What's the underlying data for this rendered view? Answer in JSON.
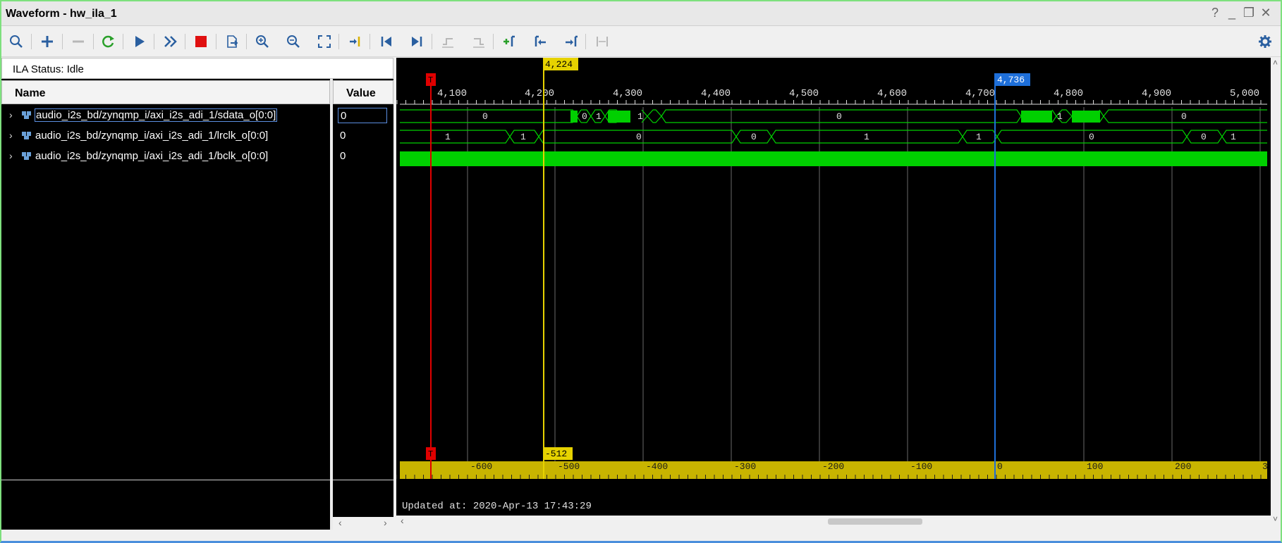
{
  "window": {
    "title": "Waveform - hw_ila_1",
    "controls": [
      "?",
      "_",
      "❐",
      "✕"
    ]
  },
  "toolbar": {
    "buttons": [
      {
        "name": "search",
        "icon": "search-icon"
      },
      {
        "name": "add",
        "icon": "plus-icon"
      },
      {
        "name": "remove",
        "icon": "minus-icon",
        "disabled": true
      },
      {
        "name": "run-trigger-immediate",
        "icon": "refresh-icon"
      },
      {
        "name": "run-trigger",
        "icon": "play-icon"
      },
      {
        "name": "run-continuous",
        "icon": "fast-forward-icon"
      },
      {
        "name": "stop",
        "icon": "stop-icon"
      },
      {
        "name": "export",
        "icon": "export-icon"
      },
      {
        "name": "zoom-in",
        "icon": "zoom-in-icon"
      },
      {
        "name": "zoom-out",
        "icon": "zoom-out-icon"
      },
      {
        "name": "zoom-fit",
        "icon": "zoom-fit-icon"
      },
      {
        "name": "go-to-cursor",
        "icon": "goto-cursor-icon"
      },
      {
        "name": "go-to-time-0",
        "icon": "go-start-icon"
      },
      {
        "name": "go-to-last-time",
        "icon": "go-end-icon"
      },
      {
        "name": "previous-transition",
        "icon": "prev-transition-icon",
        "disabled": true
      },
      {
        "name": "next-transition",
        "icon": "next-transition-icon",
        "disabled": true
      },
      {
        "name": "add-marker",
        "icon": "add-marker-icon"
      },
      {
        "name": "previous-marker",
        "icon": "prev-marker-icon"
      },
      {
        "name": "next-marker",
        "icon": "next-marker-icon"
      },
      {
        "name": "swap-cursors",
        "icon": "swap-cursors-icon",
        "disabled": true
      }
    ],
    "settings_icon": "gear-icon"
  },
  "ila_status": "ILA Status:  Idle",
  "columns": {
    "name": "Name",
    "value": "Value"
  },
  "signals": [
    {
      "name": "audio_i2s_bd/zynqmp_i/axi_i2s_adi_1/sdata_o[0:0]",
      "value": "0",
      "selected": true
    },
    {
      "name": "audio_i2s_bd/zynqmp_i/axi_i2s_adi_1/lrclk_o[0:0]",
      "value": "0",
      "selected": false
    },
    {
      "name": "audio_i2s_bd/zynqmp_i/axi_i2s_adi_1/bclk_o[0:0]",
      "value": "0",
      "selected": false
    }
  ],
  "waveform": {
    "time_ticks": [
      "4,100",
      "4,200",
      "4,300",
      "4,400",
      "4,500",
      "4,600",
      "4,700",
      "4,800",
      "4,900",
      "5,000"
    ],
    "relative_ticks": [
      "-600",
      "-500",
      "-400",
      "-300",
      "-200",
      "-100",
      "0",
      "100",
      "200",
      "3"
    ],
    "trigger_label": "T",
    "cursor_yellow": "4,224",
    "cursor_blue": "4,736",
    "delta_label": "-512",
    "updated_at": "Updated at: 2020-Apr-13 17:43:29",
    "sdata_labels": [
      "0",
      "0",
      "1",
      "1",
      "0",
      "1",
      "0"
    ],
    "lrclk_labels": [
      "1",
      "1",
      "0",
      "0",
      "1",
      "1",
      "0",
      "0",
      "1"
    ],
    "colors": {
      "trace": "#00d000",
      "yellow_cursor": "#e6d200",
      "blue_cursor": "#1e6fd9",
      "trigger": "#e00000",
      "ruler": "#c8b400"
    }
  }
}
